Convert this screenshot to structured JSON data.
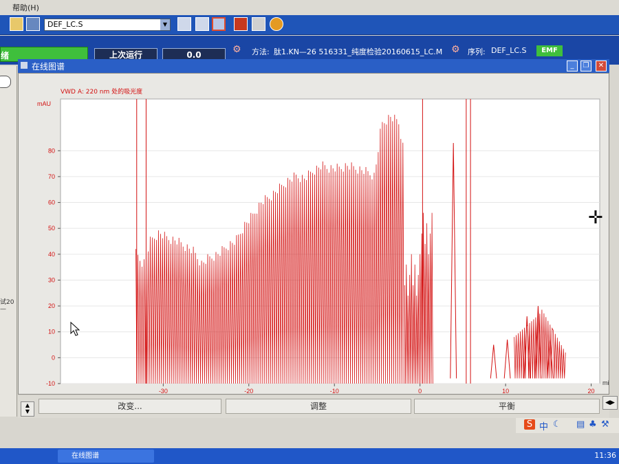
{
  "menubar": {
    "items": [
      "帮助(H)"
    ]
  },
  "toolbar": {
    "method_select": "DEF_LC.S",
    "tools": [
      "window-a-icon",
      "window-b-icon",
      "online-plot-icon",
      "stop-icon",
      "print-icon",
      "help-icon"
    ]
  },
  "status": {
    "ready_text": "绪",
    "last_run_label": "上次运行",
    "last_run_value": "0.0",
    "method_label": "方法:",
    "method_name": "肽1.KN—26 516331_纯度检验20160615_LC.M",
    "sequence_label": "序列:",
    "sequence_name": "DEF_LC.S",
    "emf_badge": "EMF"
  },
  "left_fragment_text": "试20—",
  "online_window": {
    "title": "在线图谱",
    "signal_label": "VWD A: 220 nm 处的吸光度",
    "buttons": [
      "改变...",
      "调整",
      "平衡"
    ]
  },
  "chart_data": {
    "type": "line",
    "series": [
      {
        "name": "VWD A: 220 nm 处的吸光度",
        "color": "#d31010"
      }
    ],
    "ylabel": "mAU",
    "xlabel": "min",
    "ylim": [
      -10,
      100
    ],
    "xlim": [
      -42,
      21
    ],
    "yticks": [
      -10,
      0,
      10,
      20,
      30,
      40,
      50,
      60,
      70,
      80
    ],
    "xticks": [
      -30,
      -20,
      -10,
      0,
      10,
      20
    ],
    "envelope": [
      [
        -33.2,
        42
      ],
      [
        -32.3,
        38
      ],
      [
        -31.5,
        47
      ],
      [
        -30.5,
        50
      ],
      [
        -29.5,
        48
      ],
      [
        -28.5,
        47
      ],
      [
        -27.5,
        45
      ],
      [
        -26.5,
        43
      ],
      [
        -25.5,
        38
      ],
      [
        -24.8,
        40
      ],
      [
        -23.5,
        42
      ],
      [
        -22.5,
        45
      ],
      [
        -21.5,
        47
      ],
      [
        -20.5,
        53
      ],
      [
        -19.5,
        57
      ],
      [
        -18.5,
        62
      ],
      [
        -17.5,
        64
      ],
      [
        -16.5,
        67
      ],
      [
        -15.5,
        70
      ],
      [
        -14.5,
        72
      ],
      [
        -13.5,
        71
      ],
      [
        -12.5,
        74
      ],
      [
        -11.5,
        76
      ],
      [
        -10.5,
        75
      ],
      [
        -9.5,
        75
      ],
      [
        -8.5,
        76
      ],
      [
        -7.5,
        75
      ],
      [
        -6.5,
        74
      ],
      [
        -5.3,
        72
      ],
      [
        -4.5,
        92
      ],
      [
        -3.5,
        95
      ],
      [
        -2.5,
        93
      ],
      [
        -1.8,
        80
      ]
    ],
    "spikes_x": [
      -33.1,
      -32.0,
      0.3,
      5.4,
      5.9
    ],
    "late_peaks": [
      [
        3.9,
        83
      ],
      [
        8.6,
        5
      ],
      [
        10.2,
        7
      ],
      [
        12.5,
        16
      ],
      [
        13.8,
        20
      ],
      [
        15.2,
        8
      ]
    ]
  },
  "ime": {
    "sogou": "S",
    "lang": "中"
  },
  "taskbar": {
    "item_label": "在线图谱",
    "clock": "11:36"
  },
  "colors": {
    "trace": "#d31010",
    "title_blue": "#2a5fc6",
    "ready_green": "#3fbf3c"
  }
}
